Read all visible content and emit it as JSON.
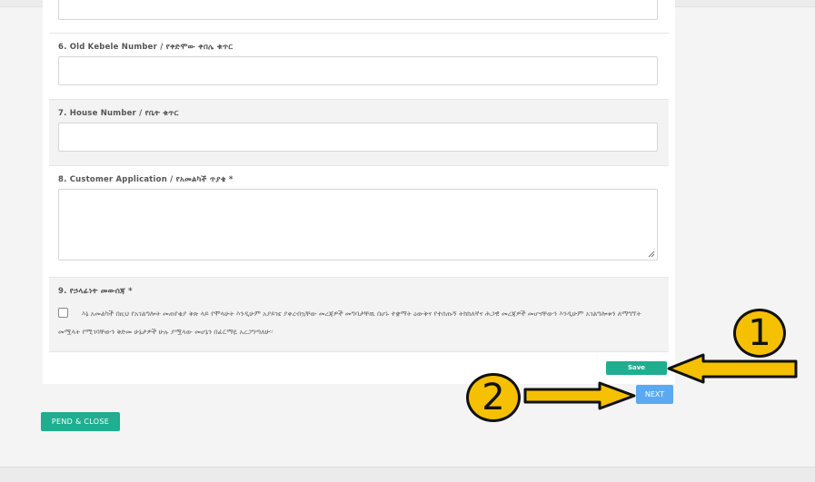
{
  "fields": {
    "old_kebele": {
      "label": "6. Old Kebele Number / የቀድሞው ቀበሌ ቁጥር",
      "value": ""
    },
    "house_number": {
      "label": "7. House Number / የቤት ቁጥር",
      "value": ""
    },
    "customer_application": {
      "label": "8. Customer Application / የአመልካች ጥያቄ *",
      "value": ""
    },
    "consent": {
      "label": "9. የኃላፊነት መውሰጃ *",
      "text": "እኔ አመልካች በዚህ የአገልግሎት መጠየቂያ ቅጽ ላይ የሞላሁት እንዲሁም አያይዤ ያቀረብኳቸው መረጃዎች መግባታቸዉ በሆኑ ተቋማት ዕውቅና የተሰጡኝ ትክክለኛና ሕጋዊ መረጃዎች መሆናቸውን እንዲሁም አገልግሎቱን ለማግኘት መሟላት የሚገባቸውን ቅድመ ሁኔታዎች ሁሉ ያሟላው መሆኔን በፊርማዬ አረጋግጣለሁ፡፡",
      "checked": false
    }
  },
  "buttons": {
    "save": "Save",
    "next": "NEXT",
    "pend_close": "PEND & CLOSE"
  },
  "annotations": {
    "callout_1": "1",
    "callout_2": "2",
    "color": "#f5c000"
  },
  "colors": {
    "primary_green": "#1fae8f",
    "next_blue": "#5aa9f2"
  }
}
